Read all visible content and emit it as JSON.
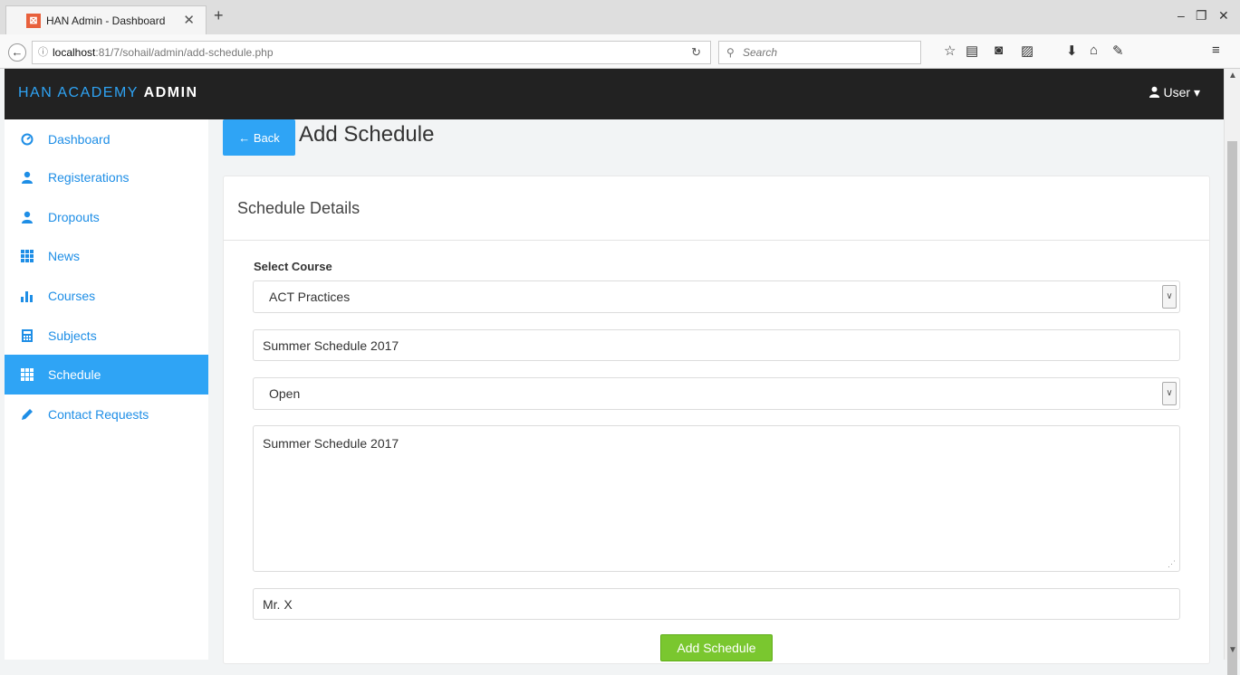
{
  "browser": {
    "tab_title": "HAN Admin - Dashboard",
    "tab_close": "✕",
    "new_tab": "+",
    "url_host": "localhost",
    "url_path": ":81/7/sohail/admin/add-schedule.php",
    "search_placeholder": "Search"
  },
  "header": {
    "brand_light": "HAN ACADEMY",
    "brand_strong": "ADMIN",
    "user_label": "User"
  },
  "sidebar": {
    "items": [
      {
        "label": "Dashboard",
        "icon": "dashboard-icon"
      },
      {
        "label": "Registerations",
        "icon": "user-icon"
      },
      {
        "label": "Dropouts",
        "icon": "user-icon"
      },
      {
        "label": "News",
        "icon": "grid-icon"
      },
      {
        "label": "Courses",
        "icon": "bar-chart-icon"
      },
      {
        "label": "Subjects",
        "icon": "calculator-icon"
      },
      {
        "label": "Schedule",
        "icon": "grid-icon",
        "active": true
      },
      {
        "label": "Contact Requests",
        "icon": "pencil-icon"
      }
    ]
  },
  "main": {
    "back_label": "Back",
    "page_title": "Add Schedule",
    "panel_title": "Schedule Details",
    "form": {
      "course_label": "Select Course",
      "course_value": "ACT Practices",
      "schedule_name": "Summer Schedule 2017",
      "status_value": "Open",
      "description": "Summer Schedule 2017",
      "instructor": "Mr. X",
      "submit_label": "Add Schedule"
    }
  },
  "colors": {
    "accent": "#2fa4f5",
    "header_bg": "#222222",
    "submit": "#7ac72f"
  }
}
